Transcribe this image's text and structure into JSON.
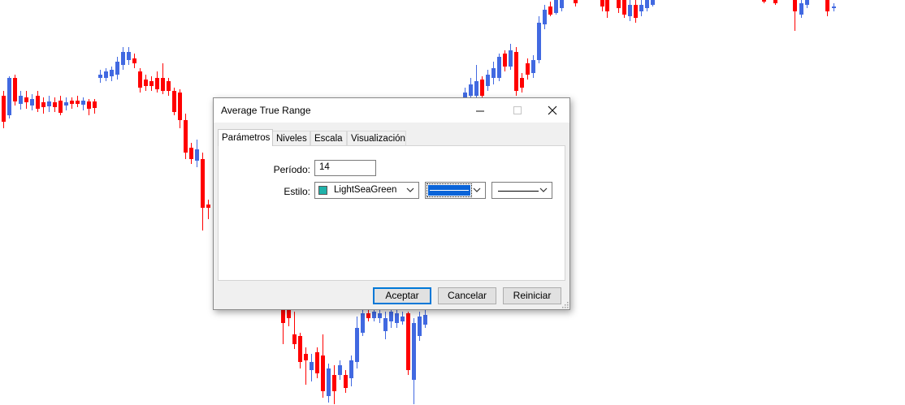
{
  "dialog": {
    "title": "Average True Range",
    "tabs": [
      {
        "label": "Parámetros",
        "active": true
      },
      {
        "label": "Niveles",
        "active": false
      },
      {
        "label": "Escala",
        "active": false
      },
      {
        "label": "Visualización",
        "active": false
      }
    ],
    "fields": {
      "period_label": "Período:",
      "period_value": "14",
      "style_label": "Estilo:",
      "color_value": "LightSeaGreen",
      "color_hex": "#20b2aa"
    },
    "buttons": {
      "accept": "Aceptar",
      "cancel": "Cancelar",
      "reset": "Reiniciar"
    }
  },
  "chart_colors": {
    "bull": "#4169e1",
    "bear": "#ff0000"
  }
}
